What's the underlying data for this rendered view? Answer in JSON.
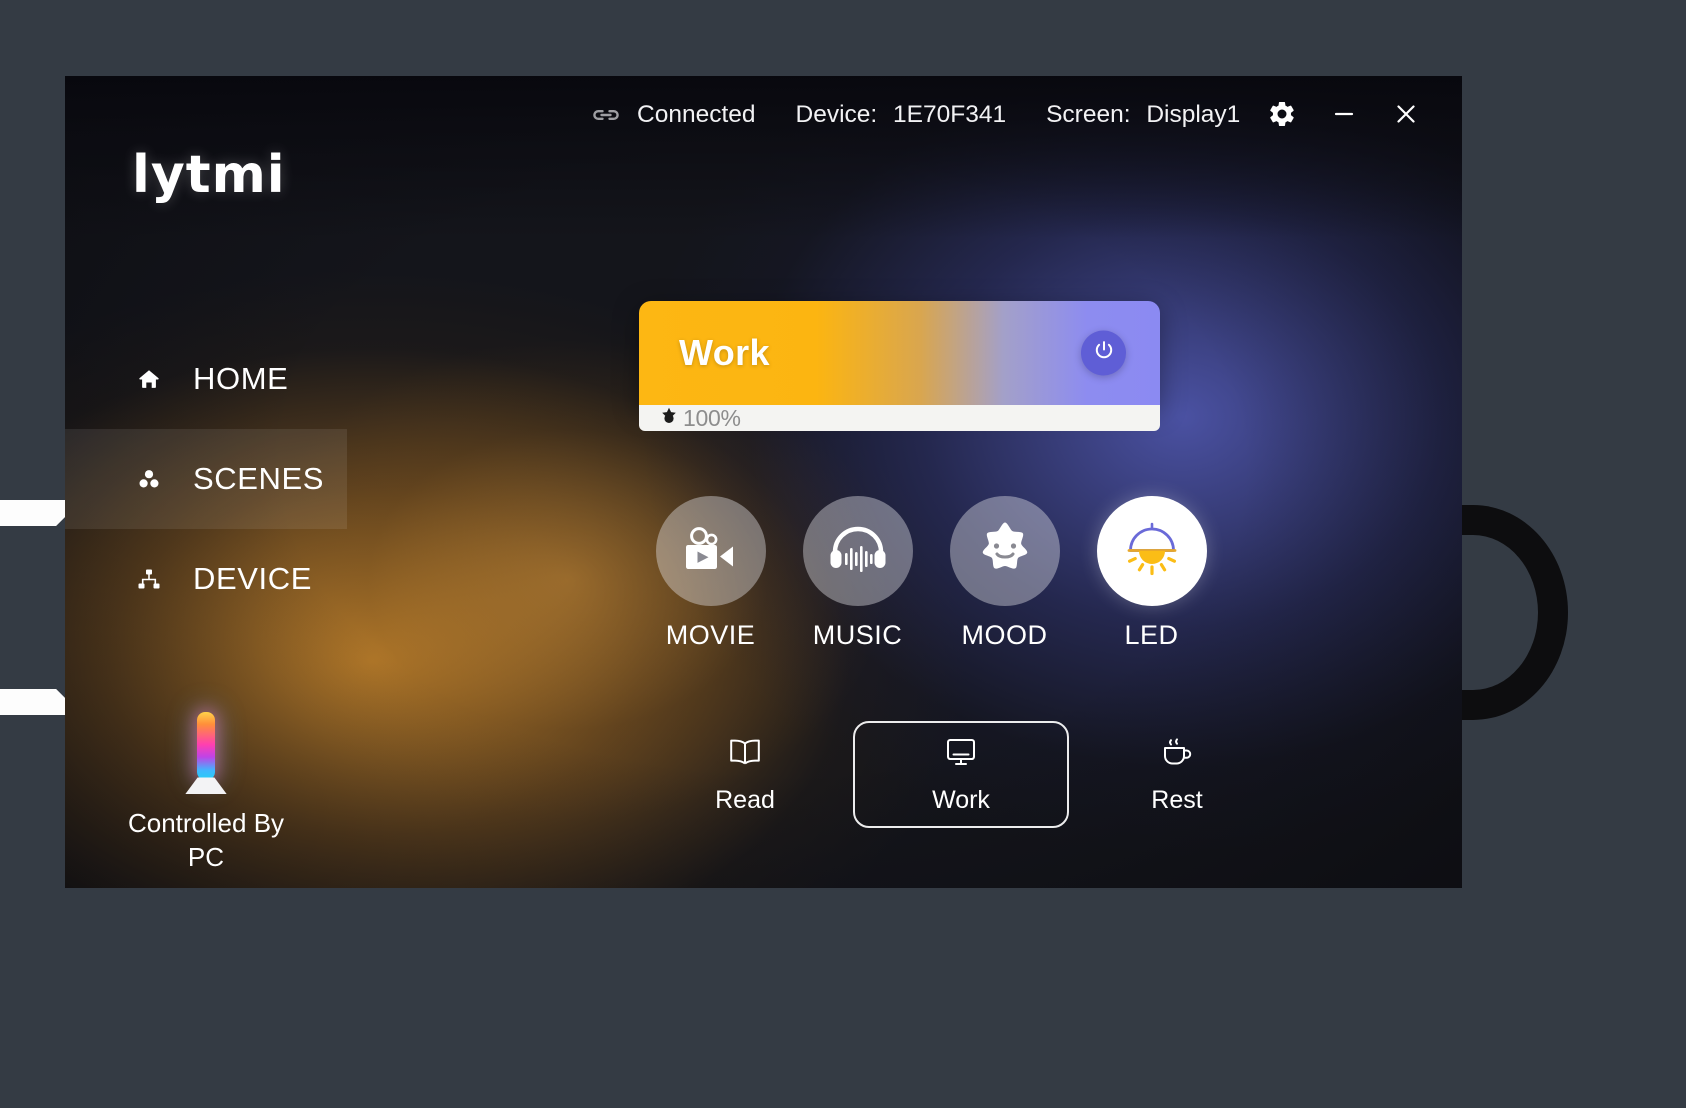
{
  "window": {
    "titlebar": {
      "link_icon": "link-icon",
      "connection_status": "Connected",
      "device_key": "Device:",
      "device_value": "1E70F341",
      "screen_key": "Screen:",
      "screen_value": "Display1",
      "settings_icon": "gear-icon",
      "minimize_icon": "minimize-icon",
      "close_icon": "close-icon"
    }
  },
  "sidebar": {
    "logo": "lytmi",
    "items": [
      {
        "label": "HOME",
        "icon": "home-icon",
        "active": false
      },
      {
        "label": "SCENES",
        "icon": "scenes-icon",
        "active": true
      },
      {
        "label": "DEVICE",
        "icon": "sitemap-icon",
        "active": false
      }
    ],
    "device": {
      "icon": "rgb-light-bar-icon",
      "caption_line1": "Controlled By",
      "caption_line2": "PC"
    }
  },
  "main": {
    "scene_card": {
      "name": "Work",
      "power_icon": "power-icon",
      "brightness_icon": "brightness-sun-icon",
      "brightness_value": "100%",
      "gradient_from": "#fdb713",
      "gradient_to": "#8b8af2"
    },
    "modes": [
      {
        "label": "MOVIE",
        "icon": "video-camera-icon",
        "selected": false
      },
      {
        "label": "MUSIC",
        "icon": "headphones-icon",
        "selected": false
      },
      {
        "label": "MOOD",
        "icon": "smiling-star-icon",
        "selected": false
      },
      {
        "label": "LED",
        "icon": "pendant-lamp-icon",
        "selected": true
      }
    ],
    "submodes": [
      {
        "label": "Read",
        "icon": "book-icon",
        "selected": false
      },
      {
        "label": "Work",
        "icon": "monitor-icon",
        "selected": true
      },
      {
        "label": "Rest",
        "icon": "coffee-icon",
        "selected": false
      }
    ]
  },
  "colors": {
    "app_background": "#14151b",
    "desktop_background": "#343b44",
    "accent_amber": "#fdb713",
    "accent_periwinkle": "#8b8af2",
    "power_button": "#5f5ed6"
  }
}
